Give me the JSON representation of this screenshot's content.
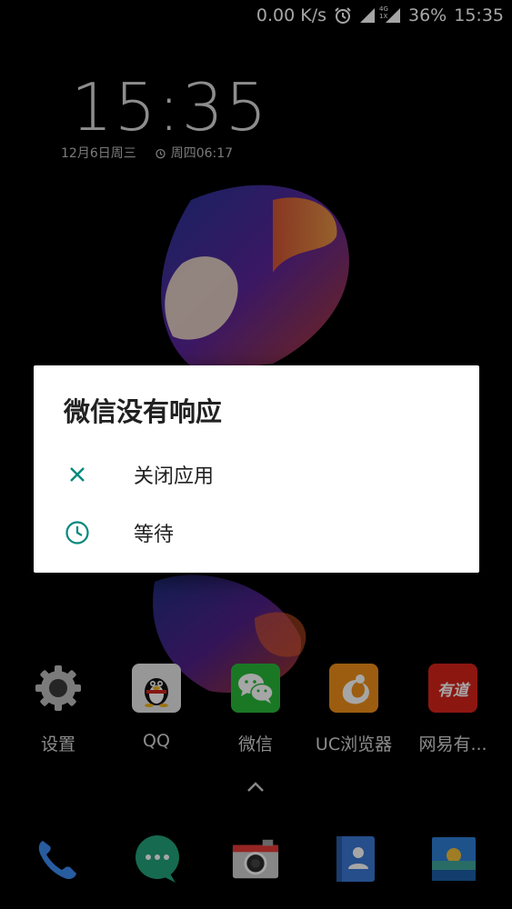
{
  "status_bar": {
    "speed": "0.00 K/s",
    "network_tags": [
      "4G",
      "1X"
    ],
    "battery": "36%",
    "time": "15:35"
  },
  "lockscreen": {
    "clock": "15:35",
    "date": "12月6日周三",
    "alarm": "周四06:17"
  },
  "dialog": {
    "title": "微信没有响应",
    "items": [
      {
        "icon": "close-icon",
        "label": "关闭应用"
      },
      {
        "icon": "clock-icon",
        "label": "等待"
      }
    ],
    "accent_color": "#00897b"
  },
  "apps": [
    {
      "icon": "settings-gear-icon",
      "label": "设置"
    },
    {
      "icon": "qq-penguin-icon",
      "label": "QQ"
    },
    {
      "icon": "wechat-icon",
      "label": "微信"
    },
    {
      "icon": "uc-browser-icon",
      "label": "UC浏览器"
    },
    {
      "icon": "youdao-icon",
      "label": "网易有...",
      "icon_text": "有道"
    }
  ],
  "dock": [
    {
      "icon": "phone-icon"
    },
    {
      "icon": "messages-icon"
    },
    {
      "icon": "camera-icon"
    },
    {
      "icon": "contacts-icon"
    },
    {
      "icon": "gallery-icon"
    }
  ]
}
